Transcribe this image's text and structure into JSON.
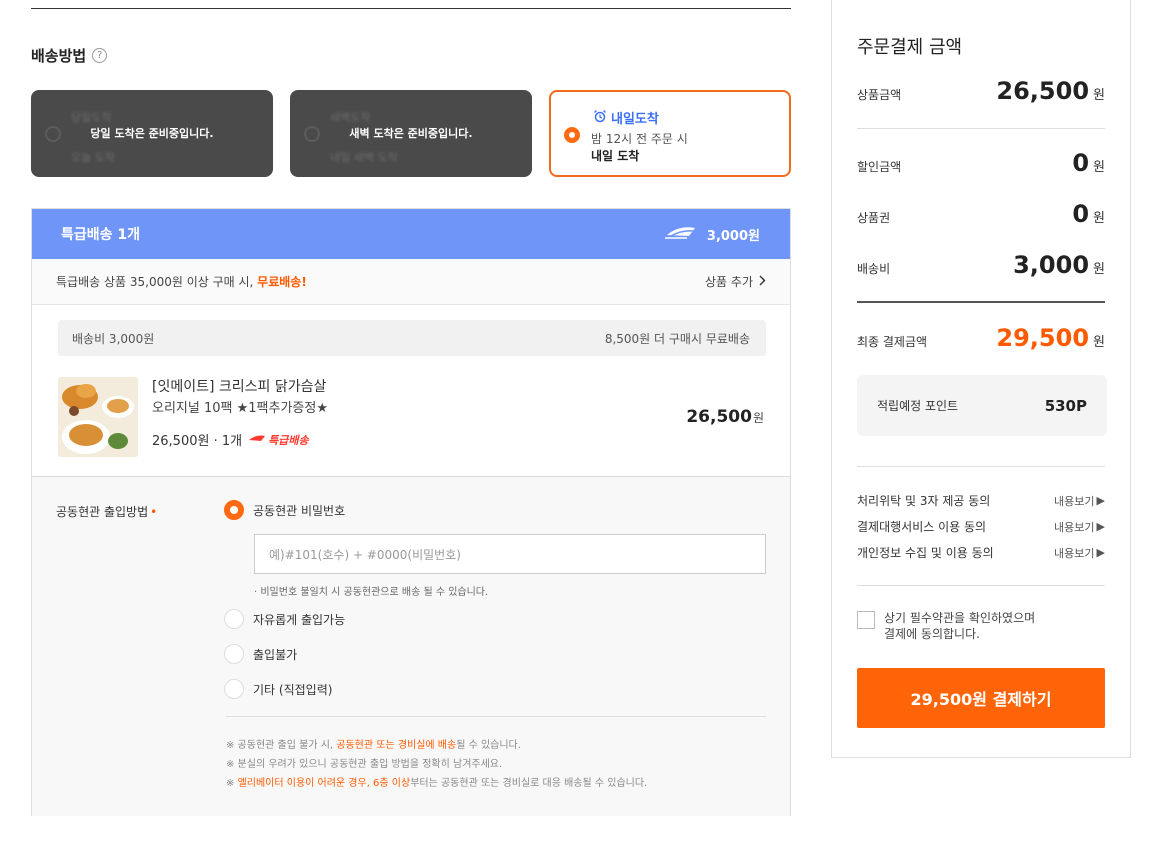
{
  "delivery_method": {
    "title": "배송방법",
    "options": [
      {
        "label": "당일도착",
        "sub": "오늘 도착",
        "message": "당일 도착은 준비중입니다.",
        "disabled": true
      },
      {
        "label": "새벽도착",
        "sub": "내일 새벽 도착",
        "message": "새벽 도착은 준비중입니다.",
        "disabled": true
      },
      {
        "label": "내일도착",
        "line1": "밤 12시 전 주문 시",
        "line2": "내일 도착",
        "selected": true
      }
    ]
  },
  "express": {
    "header_label": "특급배송 1개",
    "header_fee": "3,000원",
    "free_notice_prefix": "특급배송 상품 35,000원 이상 구매 시, ",
    "free_notice_highlight": "무료배송!",
    "add_product": "상품 추가",
    "fee_label": "배송비 3,000원",
    "fee_remaining": "8,500원 더 구매시 무료배송"
  },
  "product": {
    "name": "[잇메이트] 크리스피 닭가슴살",
    "option": "오리지널 10팩 ★1팩추가증정★",
    "price_qty": "26,500원 · 1개",
    "badge": "특급배송",
    "total": "26,500",
    "total_unit": "원"
  },
  "entry": {
    "label": "공동현관 출입방법",
    "required_mark": "•",
    "options": [
      "공동현관 비밀번호",
      "자유롭게 출입가능",
      "출입불가",
      "기타 (직접입력)"
    ],
    "selected_index": 0,
    "input_placeholder": "예)#101(호수) + #0000(비밀번호)",
    "help": "· 비밀번호 불일치 시 공동현관으로 배송 될 수 있습니다.",
    "note1_a": "※ 공동현관 출입 불가 시, ",
    "note1_b": "공동현관 또는 경비실에 배송",
    "note1_c": "될 수 있습니다.",
    "note2": "※ 분실의 우려가 있으니 공동현관 출입 방법을 정확히 남겨주세요.",
    "note3_a": "※ ",
    "note3_b": "엘리베이터 이용이 어려운 경우, 6층 이상",
    "note3_c": "부터는 공동현관 또는 경비실로 대응 배송될 수 있습니다."
  },
  "summary": {
    "title": "주문결제 금액",
    "product_amount_label": "상품금액",
    "product_amount": "26,500",
    "discount_label": "할인금액",
    "discount": "0",
    "voucher_label": "상품권",
    "voucher": "0",
    "shipping_label": "배송비",
    "shipping": "3,000",
    "final_label": "최종 결제금액",
    "final": "29,500",
    "unit": "원",
    "points_label": "적립예정 포인트",
    "points": "530P",
    "agreements": [
      "처리위탁 및 3자 제공 동의",
      "결제대행서비스 이용 동의",
      "개인정보 수집 및 이용 동의"
    ],
    "view_label": "내용보기",
    "agree_all_line1": "상기 필수약관을 확인하였으며",
    "agree_all_line2": "결제에 동의합니다.",
    "pay_button": "29,500원 결제하기"
  },
  "colors": {
    "accent": "#ff6508",
    "express_blue": "#6f95f9",
    "tomorrow_blue": "#3b6ff5"
  }
}
